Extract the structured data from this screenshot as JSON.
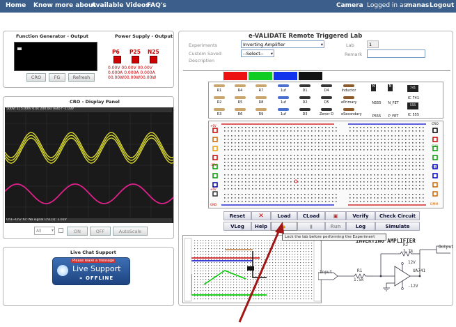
{
  "nav": {
    "home": "Home",
    "know_more": "Know more about",
    "videos": "Available Videos",
    "faq": "FAQ's",
    "camera": "Camera",
    "logged_in": "Logged in as",
    "username": "manas",
    "logout": "Logout"
  },
  "funcgen": {
    "title": "Function Generator - Output",
    "ps_title": "Power Supply - Output",
    "btn_cro": "CRO",
    "btn_fg": "FG",
    "btn_refresh": "Refresh",
    "channels": [
      "P6",
      "P25",
      "N25"
    ],
    "readings_row1": [
      "0.00V",
      "00.00V",
      "00.00V"
    ],
    "readings_row2": [
      "0.000A",
      "0.000A",
      "0.000A"
    ],
    "readings_row3": [
      "00.00W",
      "00.00W",
      "00.00W"
    ]
  },
  "cro": {
    "title": "CRO - Display Panel",
    "status_top": "500V/    1|  5.00V/    0.0s   200.0s/   Auto   f   -1.03V",
    "status_bottom": "Ch1~Ch2  Xc: No signal     Ch1(1): 1.02V",
    "select_value": "All",
    "btn_on": "ON",
    "btn_off": "OFF",
    "btn_autoscale": "AutoScale"
  },
  "chat": {
    "title": "Live Chat Support",
    "banner_top": "Please leave a message",
    "banner_main": "Live Support",
    "banner_status": "OFFLINE"
  },
  "lab": {
    "title": "e-VALIDATE Remote Triggered Lab",
    "experiments_label": "Experiments",
    "experiment_value": "Inverting Amplifier",
    "lab_label": "Lab",
    "lab_value": "1",
    "custom_label": "Custom Saved",
    "description_label": "Description",
    "select_placeholder": "--Select--",
    "remark_label": "Remark",
    "remark_value": ""
  },
  "components": {
    "row1": [
      "R1",
      "R4",
      "R7",
      "1uf",
      "D1",
      "D4",
      "Inductor"
    ],
    "row2": [
      "R2",
      "R5",
      "R8",
      "1uf",
      "D2",
      "D5",
      "ePrimary"
    ],
    "row3": [
      "R3",
      "R6",
      "R9",
      "1uf",
      "D3",
      "Zener D",
      "eSecondary"
    ],
    "ics": [
      "N",
      "N",
      "N555",
      "N_FET",
      "P555",
      "P_FET",
      "IC 741",
      "IC 555",
      "741",
      "555"
    ],
    "swatch_colors": [
      "#ee1111",
      "#11cc22",
      "#1133ee",
      "#111111"
    ]
  },
  "breadboard": {
    "left_labels": [
      "+6V",
      "-25V",
      "+6V",
      "GND"
    ],
    "right_labels": [
      "CRO",
      "CH1",
      "CH2",
      "DMM"
    ]
  },
  "actions": {
    "row1": [
      "Reset",
      "",
      "Load",
      "CLoad",
      "",
      "Verify",
      "Check Circuit"
    ],
    "row2": [
      "VLog",
      "Help",
      "",
      "",
      "Run",
      "Log",
      "Simulate"
    ]
  },
  "tooltip": "Lock the lab before performing the Experiment",
  "schematic": {
    "title": "INVERTING AMPLIFIER",
    "r2_name": "R2",
    "r2_value": "2.7k",
    "r1_name": "R1",
    "r1_value": "1.5k",
    "input_label": "Input",
    "output_label": "Output",
    "opamp": "UA741",
    "vpos": "12V",
    "vneg": "-12V"
  }
}
